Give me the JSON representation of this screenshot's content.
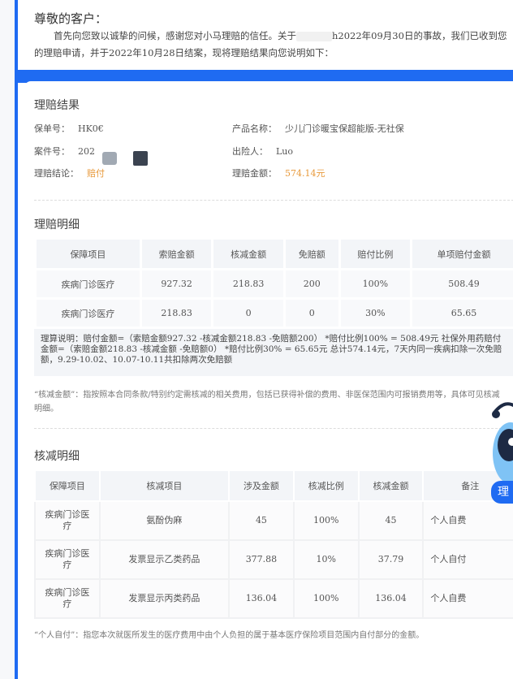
{
  "header": {
    "greeting": "尊敬的客户：",
    "intro_part1": "首先向您致以诚挚的问候，感谢您对小马理赔的信任。关于",
    "intro_part2": "h2022年09月30日的事故，我们已收到您的理赔申请，并于2022年10月28日结案，现将理赔结果向您说明如下："
  },
  "result": {
    "title": "理赔结果",
    "policy_label": "保单号：",
    "policy_value": "HK0€",
    "product_label": "产品名称：",
    "product_value": "少儿门诊暖宝保超能版-无社保",
    "case_label": "案件号：",
    "case_value": "202",
    "insured_label": "出险人：",
    "insured_value": "Luo",
    "conclusion_label": "理赔结论：",
    "conclusion_value": "赔付",
    "amount_label": "理赔金额：",
    "amount_value": "574.14元",
    "accent_color": "#e89a3c"
  },
  "detail": {
    "title": "理赔明细",
    "headers": [
      "保障项目",
      "索赔金额",
      "核减金额",
      "免赔额",
      "赔付比例",
      "单项赔付金额"
    ],
    "rows": [
      [
        "疾病门诊医疗",
        "927.32",
        "218.83",
        "200",
        "100%",
        "508.49"
      ],
      [
        "疾病门诊医疗",
        "218.83",
        "0",
        "0",
        "30%",
        "65.65"
      ]
    ],
    "calc": "理算说明：赔付金额=（索赔金额927.32 -核减金额218.83 -免赔额200） *赔付比例100% = 508.49元 社保外用药赔付金额=（索赔金额218.83 -核减金额 -免赔额0） *赔付比例30% = 65.65元 总计574.14元，7天内同一疾病扣除一次免赔额，9.29-10.02、10.07-10.11共扣除两次免赔额",
    "note": "“核减金额”：指按照本合同条款/特别约定需核减的相关费用，包括已获得补偿的费用、非医保范围内可报销费用等，具体可见核减明细。"
  },
  "deduction": {
    "title": "核减明细",
    "headers": [
      "保障项目",
      "核减项目",
      "涉及金额",
      "核减比例",
      "核减金额",
      "备注"
    ],
    "rows": [
      [
        "疾病门诊医疗",
        "氨酚伪麻",
        "45",
        "100%",
        "45",
        "个人自费"
      ],
      [
        "疾病门诊医疗",
        "发票显示乙类药品",
        "377.88",
        "10%",
        "37.79",
        "个人自付"
      ],
      [
        "疾病门诊医疗",
        "发票显示丙类药品",
        "136.04",
        "100%",
        "136.04",
        "个人自费"
      ]
    ],
    "note": "“个人自付”：指您本次就医所发生的医疗费用中由个人负担的属于基本医疗保险项目范围内自付部分的金额。"
  },
  "mascot": {
    "button_label": "理"
  },
  "colors": {
    "brand": "#1f6bf2"
  }
}
